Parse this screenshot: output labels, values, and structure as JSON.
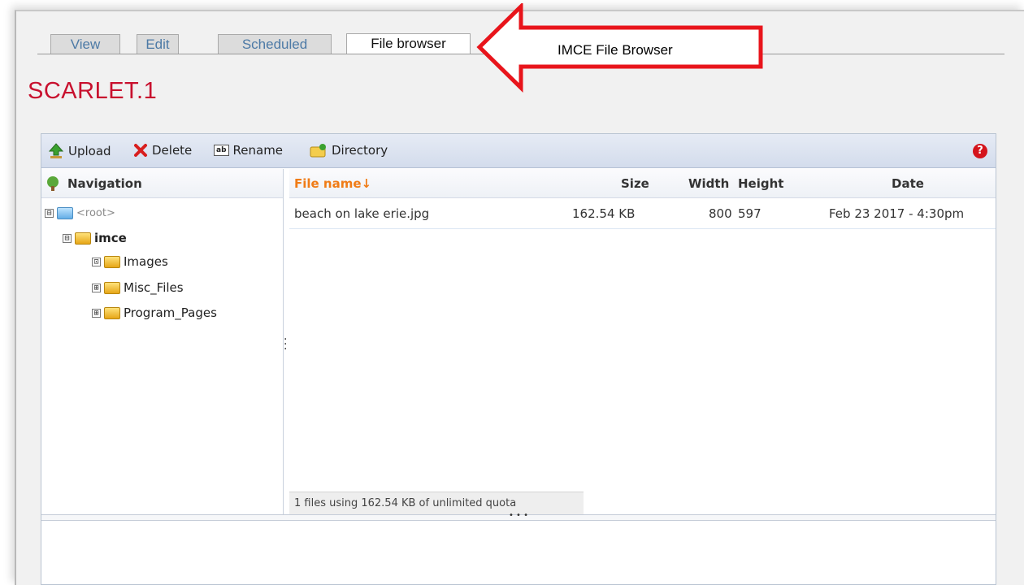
{
  "tabs": [
    {
      "label": "View"
    },
    {
      "label": "Edit"
    },
    {
      "label": "Scheduled"
    },
    {
      "label": "File browser"
    }
  ],
  "callout": {
    "text": "IMCE File Browser",
    "color": "#e8141b"
  },
  "page": {
    "title": "SCARLET.1"
  },
  "toolbar": {
    "upload": "Upload",
    "delete": "Delete",
    "rename": "Rename",
    "directory": "Directory",
    "rename_badge": "ab"
  },
  "navigation": {
    "header": "Navigation",
    "tree": [
      {
        "label": "<root>",
        "expander": "⊟"
      },
      {
        "label": "imce",
        "expander": "⊟"
      },
      {
        "label": "Images",
        "expander": "⊡"
      },
      {
        "label": "Misc_Files",
        "expander": "⊞"
      },
      {
        "label": "Program_Pages",
        "expander": "⊞"
      }
    ]
  },
  "files": {
    "columns": {
      "name": "File name↓",
      "size": "Size",
      "width": "Width",
      "height": "Height",
      "date": "Date"
    },
    "rows": [
      {
        "name": "beach on lake erie.jpg",
        "size": "162.54 KB",
        "width": "800",
        "height": "597",
        "date": "Feb 23 2017 - 4:30pm"
      }
    ]
  },
  "status": {
    "text": "1 files using 162.54 KB of unlimited quota"
  },
  "colors": {
    "title": "#c8102e",
    "header_accent": "#f07c16",
    "help": "#d4141c"
  }
}
